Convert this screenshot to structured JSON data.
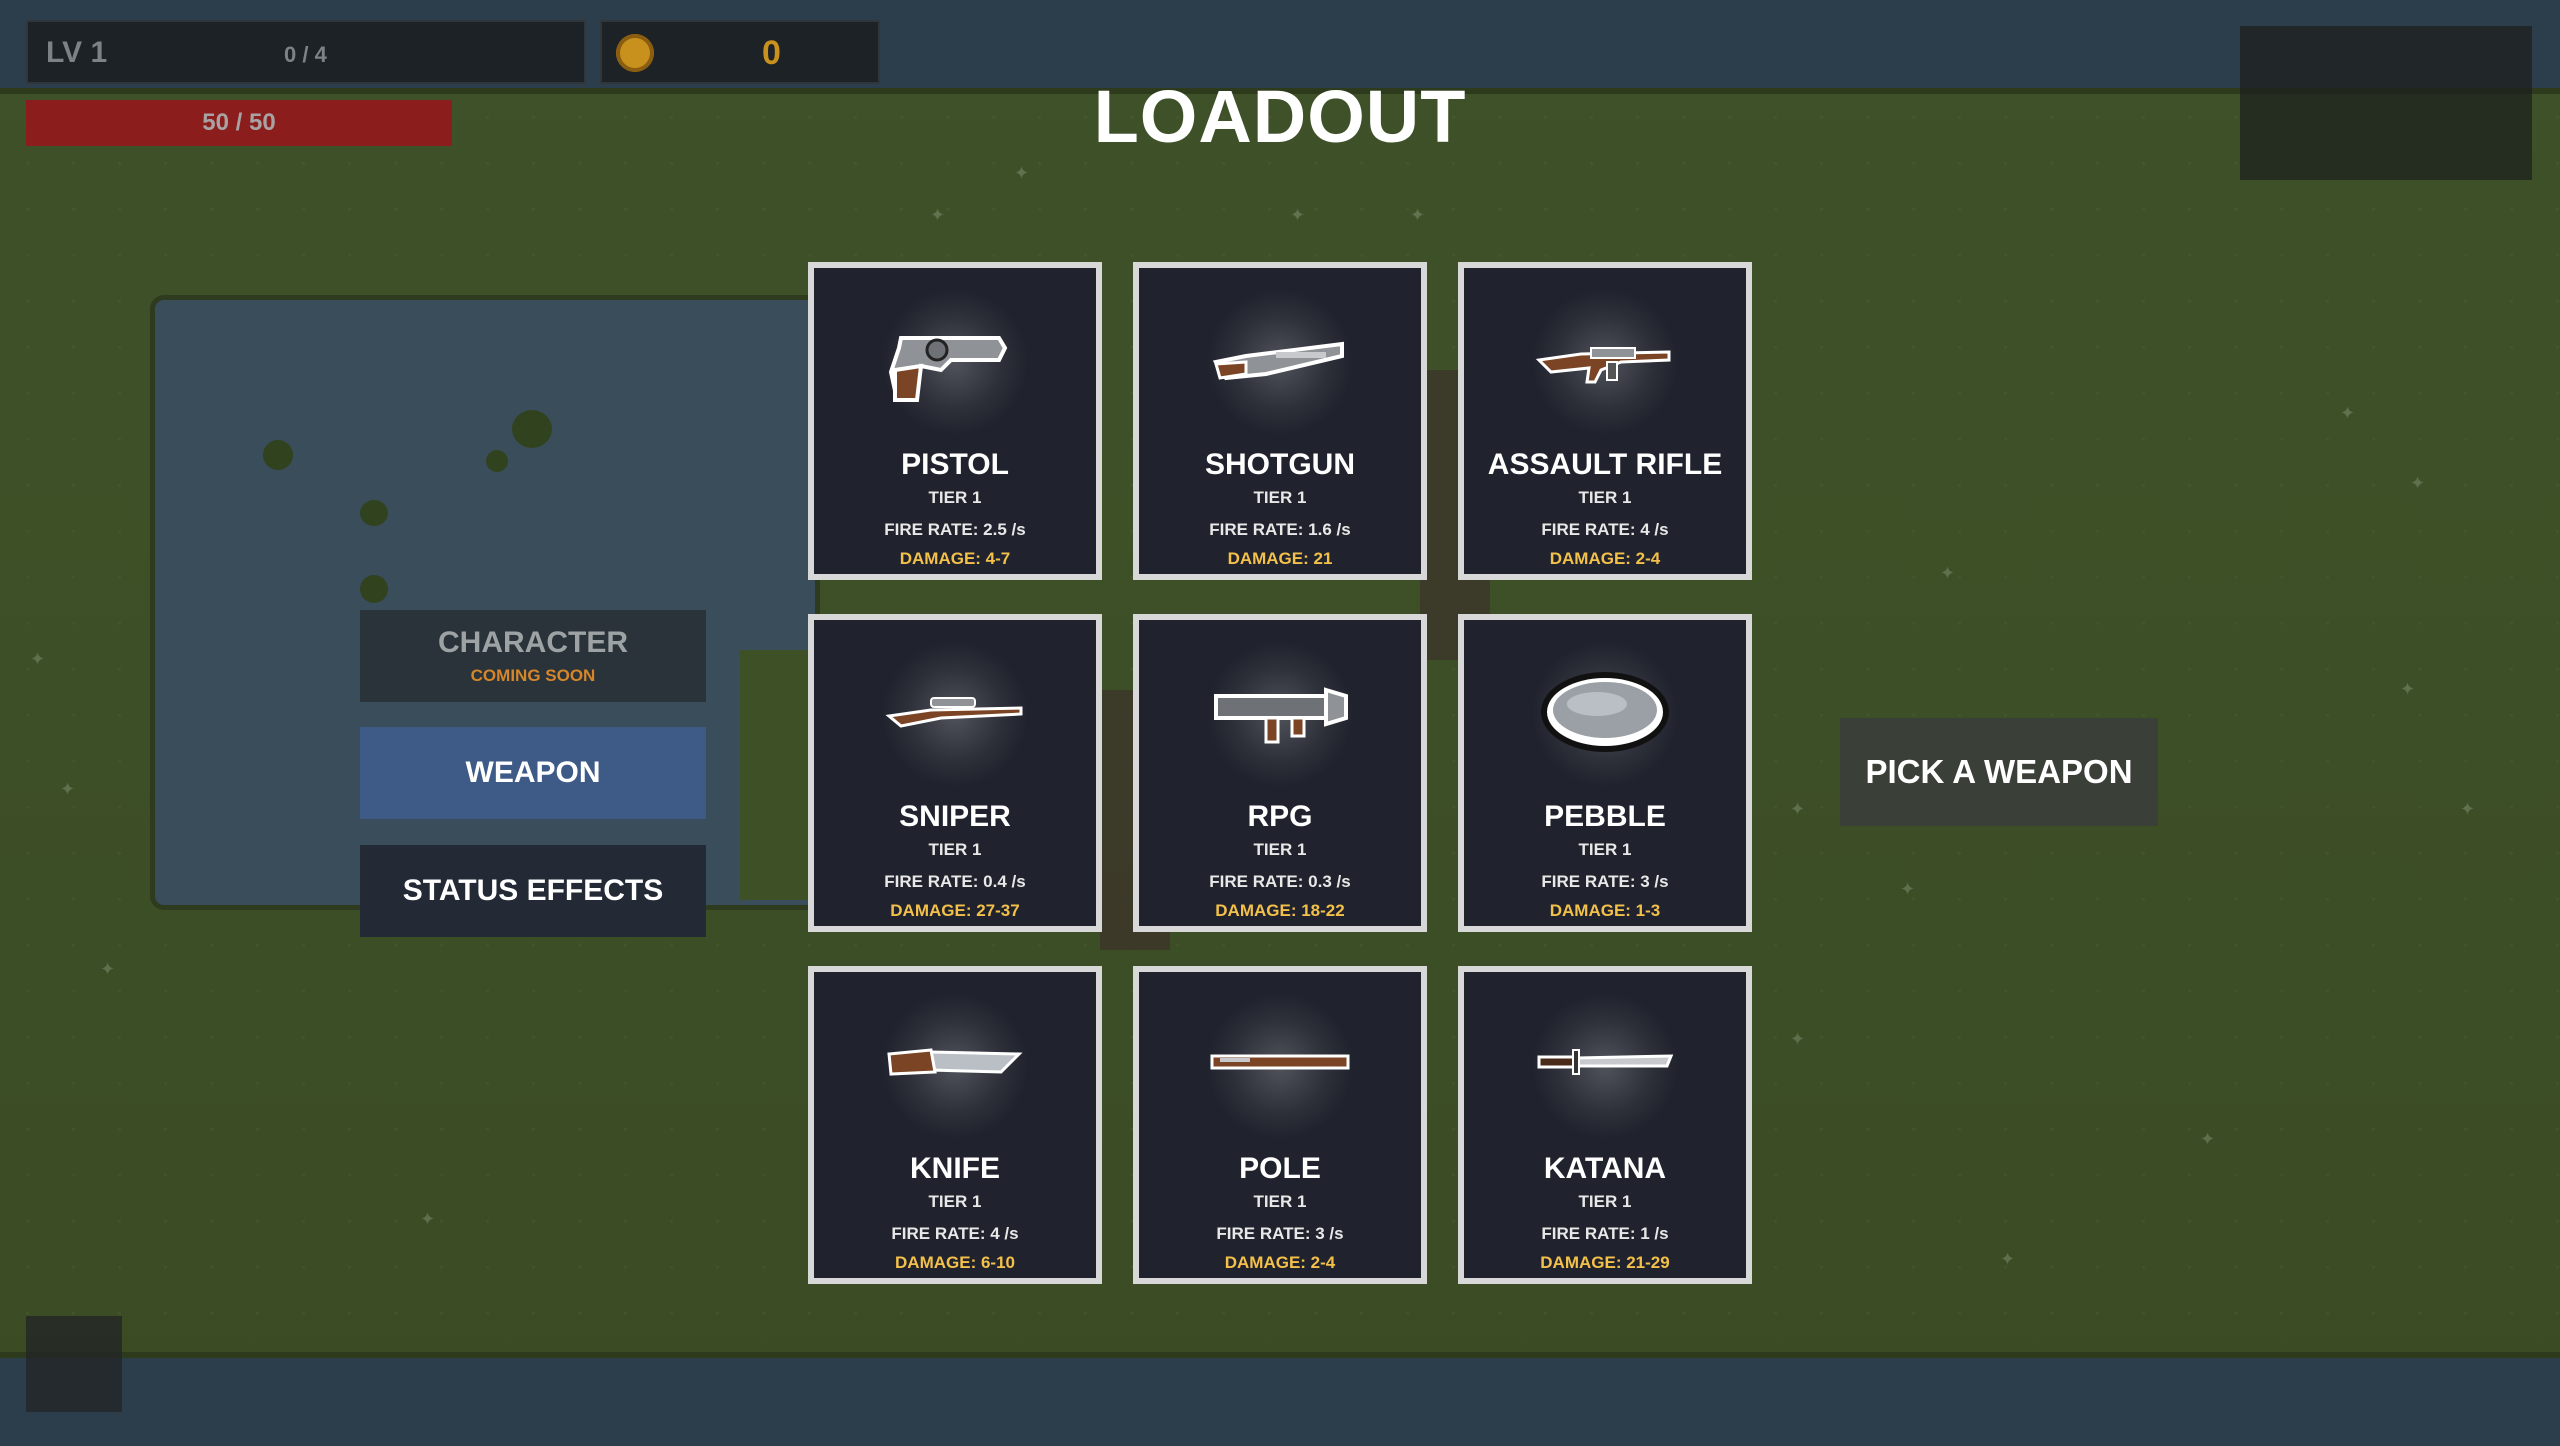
{
  "hud": {
    "level": "LV 1",
    "xp": "0 / 4",
    "gold": "0",
    "health": "50 / 50",
    "health_fraction": 1.0,
    "gold_color": "#c8901c",
    "health_color": "#8b1d1d"
  },
  "title": "LOADOUT",
  "menu": {
    "character": "CHARACTER",
    "character_sub": "COMING SOON",
    "weapon": "WEAPON",
    "status": "STATUS EFFECTS",
    "selected": "WEAPON",
    "selected_color": "#3d5b86"
  },
  "weapons": [
    {
      "name": "PISTOL",
      "tier": "TIER 1",
      "fire_rate": "FIRE RATE: 2.5 /s",
      "damage": "DAMAGE: 4-7",
      "icon": "pistol-icon"
    },
    {
      "name": "SHOTGUN",
      "tier": "TIER 1",
      "fire_rate": "FIRE RATE: 1.6 /s",
      "damage": "DAMAGE: 21",
      "icon": "shotgun-icon"
    },
    {
      "name": "ASSAULT RIFLE",
      "tier": "TIER 1",
      "fire_rate": "FIRE RATE: 4 /s",
      "damage": "DAMAGE: 2-4",
      "icon": "assault-rifle-icon"
    },
    {
      "name": "SNIPER",
      "tier": "TIER 1",
      "fire_rate": "FIRE RATE: 0.4 /s",
      "damage": "DAMAGE: 27-37",
      "icon": "sniper-icon"
    },
    {
      "name": "RPG",
      "tier": "TIER 1",
      "fire_rate": "FIRE RATE: 0.3 /s",
      "damage": "DAMAGE: 18-22",
      "icon": "rpg-icon"
    },
    {
      "name": "PEBBLE",
      "tier": "TIER 1",
      "fire_rate": "FIRE RATE: 3 /s",
      "damage": "DAMAGE: 1-3",
      "icon": "pebble-icon"
    },
    {
      "name": "KNIFE",
      "tier": "TIER 1",
      "fire_rate": "FIRE RATE: 4 /s",
      "damage": "DAMAGE: 6-10",
      "icon": "knife-icon"
    },
    {
      "name": "POLE",
      "tier": "TIER 1",
      "fire_rate": "FIRE RATE: 3 /s",
      "damage": "DAMAGE: 2-4",
      "icon": "pole-icon"
    },
    {
      "name": "KATANA",
      "tier": "TIER 1",
      "fire_rate": "FIRE RATE: 1 /s",
      "damage": "DAMAGE: 21-29",
      "icon": "katana-icon"
    }
  ],
  "pick_button": "PICK A WEAPON",
  "damage_color": "#f3c04a"
}
